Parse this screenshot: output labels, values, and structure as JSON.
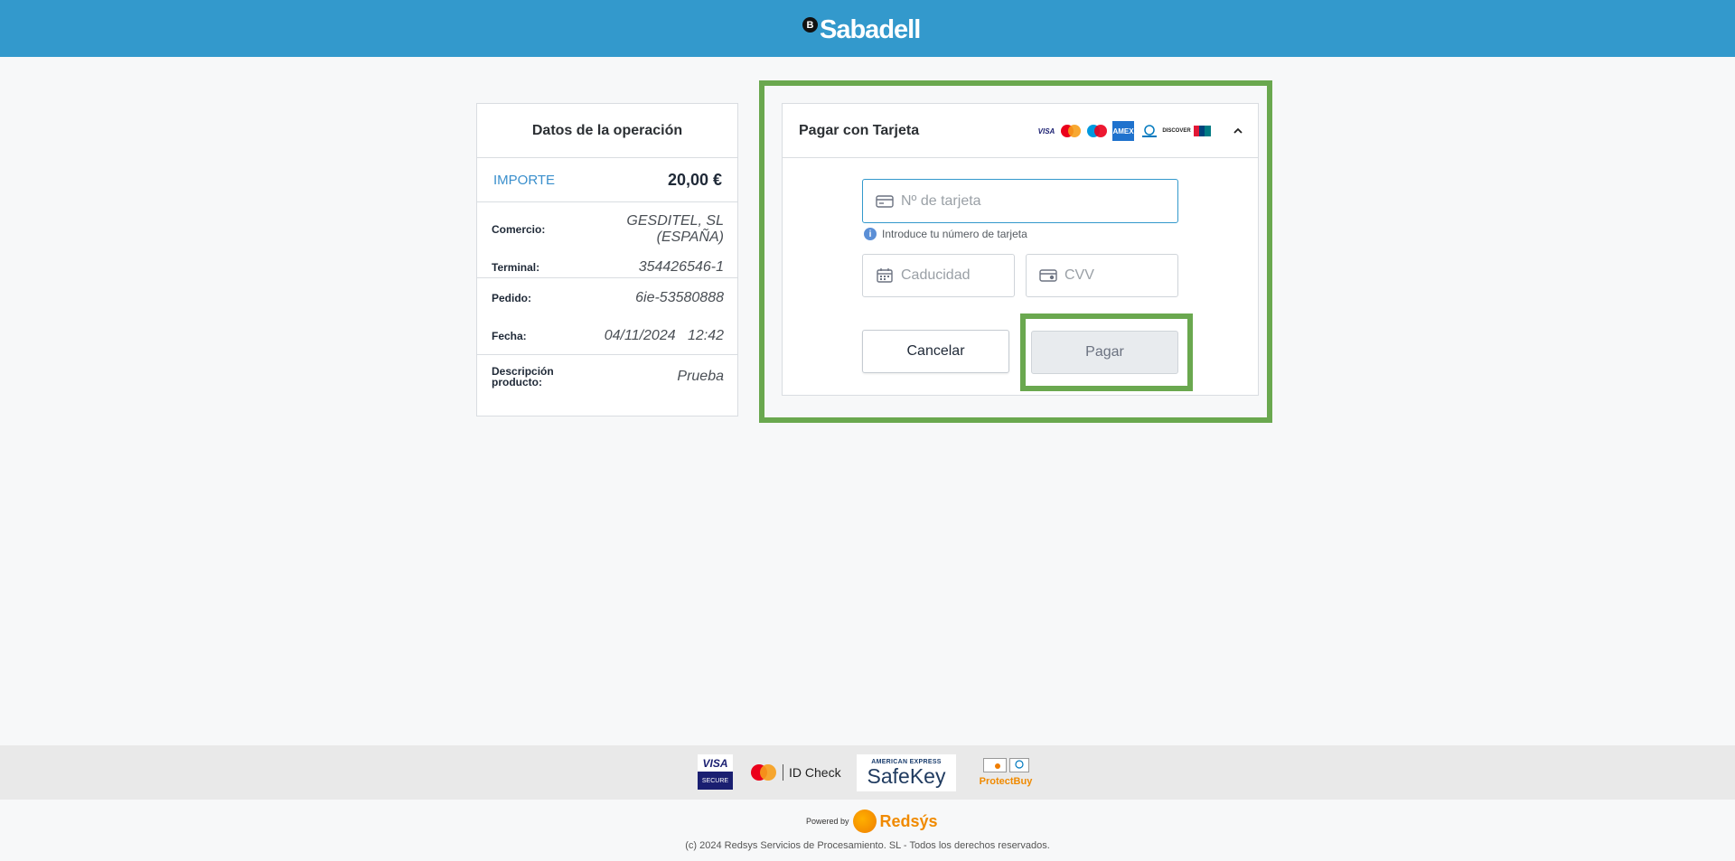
{
  "header": {
    "logo_mark": "B",
    "logo_text": "Sabadell",
    "color": "#3399cc"
  },
  "summary": {
    "title": "Datos de la operación",
    "amount_label": "IMPORTE",
    "amount_value": "20,00 €",
    "rows": [
      {
        "label": "Comercio:",
        "value": "GESDITEL, SL (ESPAÑA)"
      },
      {
        "label": "Terminal:",
        "value": "354426546-1"
      },
      {
        "label": "Pedido:",
        "value": "6ie-53580888"
      },
      {
        "label": "Fecha:",
        "value": "04/11/2024   12:42"
      },
      {
        "label": "Descripción producto:",
        "value": "Prueba"
      }
    ]
  },
  "payment": {
    "title": "Pagar con Tarjeta",
    "brands": [
      "VISA",
      "mastercard",
      "maestro",
      "AMEX",
      "diners",
      "DISCOVER",
      "UnionPay"
    ],
    "card_number_placeholder": "Nº de tarjeta",
    "card_hint": "Introduce tu número de tarjeta",
    "expiry_placeholder": "Caducidad",
    "cvv_placeholder": "CVV",
    "cancel_label": "Cancelar",
    "pay_label": "Pagar",
    "collapse_icon": "chevron-up-icon"
  },
  "footer": {
    "visa_secure": {
      "top": "VISA",
      "bottom": "SECURE"
    },
    "id_check": "ID Check",
    "amex_top": "AMERICAN EXPRESS",
    "safekey": "SafeKey",
    "protectbuy": "ProtectBuy",
    "powered_by": "Powered by",
    "redsys": "Redsýs",
    "copyright": "(c) 2024 Redsys Servicios de Procesamiento. SL - Todos los derechos reservados."
  },
  "accent_colors": {
    "highlight": "#6aa84f",
    "link_blue": "#3a8fcc"
  }
}
